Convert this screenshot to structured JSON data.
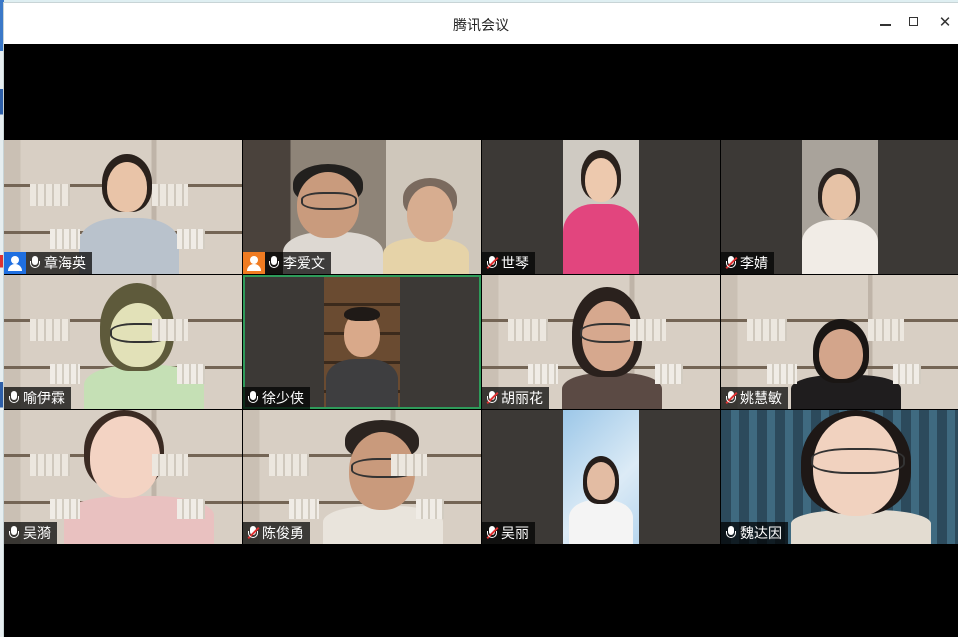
{
  "window": {
    "title": "腾讯会议"
  },
  "colors": {
    "host_badge_blue": "#1f6fe0",
    "cohost_badge_orange": "#f07b21",
    "active_speaker": "#2e9b5a",
    "muted_red": "#e03131"
  },
  "participants": [
    {
      "name": "章海英",
      "mic": "on",
      "badge": "host"
    },
    {
      "name": "李爱文",
      "mic": "on",
      "badge": "cohost"
    },
    {
      "name": "世琴",
      "mic": "muted",
      "badge": ""
    },
    {
      "name": "李婧",
      "mic": "muted",
      "badge": ""
    },
    {
      "name": "喻伊霖",
      "mic": "on",
      "badge": ""
    },
    {
      "name": "徐少侠",
      "mic": "on",
      "badge": "",
      "active": true
    },
    {
      "name": "胡丽花",
      "mic": "muted",
      "badge": ""
    },
    {
      "name": "姚慧敏",
      "mic": "muted",
      "badge": ""
    },
    {
      "name": "吴漪",
      "mic": "on",
      "badge": ""
    },
    {
      "name": "陈俊勇",
      "mic": "muted",
      "badge": ""
    },
    {
      "name": "吴丽",
      "mic": "muted",
      "badge": ""
    },
    {
      "name": "魏达因",
      "mic": "on",
      "badge": ""
    }
  ]
}
